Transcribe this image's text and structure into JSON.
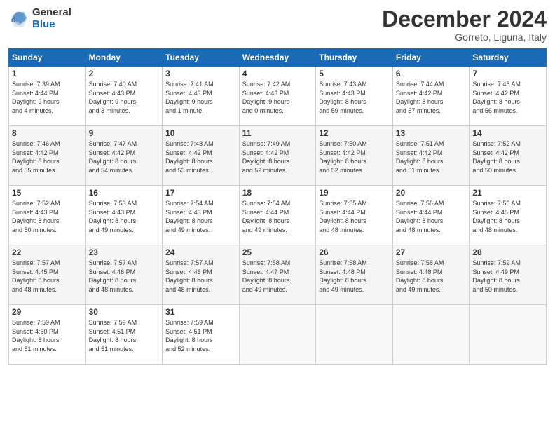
{
  "logo": {
    "general": "General",
    "blue": "Blue"
  },
  "title": "December 2024",
  "subtitle": "Gorreto, Liguria, Italy",
  "days_header": [
    "Sunday",
    "Monday",
    "Tuesday",
    "Wednesday",
    "Thursday",
    "Friday",
    "Saturday"
  ],
  "weeks": [
    [
      {
        "day": "1",
        "info": "Sunrise: 7:39 AM\nSunset: 4:44 PM\nDaylight: 9 hours\nand 4 minutes."
      },
      {
        "day": "2",
        "info": "Sunrise: 7:40 AM\nSunset: 4:43 PM\nDaylight: 9 hours\nand 3 minutes."
      },
      {
        "day": "3",
        "info": "Sunrise: 7:41 AM\nSunset: 4:43 PM\nDaylight: 9 hours\nand 1 minute."
      },
      {
        "day": "4",
        "info": "Sunrise: 7:42 AM\nSunset: 4:43 PM\nDaylight: 9 hours\nand 0 minutes."
      },
      {
        "day": "5",
        "info": "Sunrise: 7:43 AM\nSunset: 4:43 PM\nDaylight: 8 hours\nand 59 minutes."
      },
      {
        "day": "6",
        "info": "Sunrise: 7:44 AM\nSunset: 4:42 PM\nDaylight: 8 hours\nand 57 minutes."
      },
      {
        "day": "7",
        "info": "Sunrise: 7:45 AM\nSunset: 4:42 PM\nDaylight: 8 hours\nand 56 minutes."
      }
    ],
    [
      {
        "day": "8",
        "info": "Sunrise: 7:46 AM\nSunset: 4:42 PM\nDaylight: 8 hours\nand 55 minutes."
      },
      {
        "day": "9",
        "info": "Sunrise: 7:47 AM\nSunset: 4:42 PM\nDaylight: 8 hours\nand 54 minutes."
      },
      {
        "day": "10",
        "info": "Sunrise: 7:48 AM\nSunset: 4:42 PM\nDaylight: 8 hours\nand 53 minutes."
      },
      {
        "day": "11",
        "info": "Sunrise: 7:49 AM\nSunset: 4:42 PM\nDaylight: 8 hours\nand 52 minutes."
      },
      {
        "day": "12",
        "info": "Sunrise: 7:50 AM\nSunset: 4:42 PM\nDaylight: 8 hours\nand 52 minutes."
      },
      {
        "day": "13",
        "info": "Sunrise: 7:51 AM\nSunset: 4:42 PM\nDaylight: 8 hours\nand 51 minutes."
      },
      {
        "day": "14",
        "info": "Sunrise: 7:52 AM\nSunset: 4:42 PM\nDaylight: 8 hours\nand 50 minutes."
      }
    ],
    [
      {
        "day": "15",
        "info": "Sunrise: 7:52 AM\nSunset: 4:43 PM\nDaylight: 8 hours\nand 50 minutes."
      },
      {
        "day": "16",
        "info": "Sunrise: 7:53 AM\nSunset: 4:43 PM\nDaylight: 8 hours\nand 49 minutes."
      },
      {
        "day": "17",
        "info": "Sunrise: 7:54 AM\nSunset: 4:43 PM\nDaylight: 8 hours\nand 49 minutes."
      },
      {
        "day": "18",
        "info": "Sunrise: 7:54 AM\nSunset: 4:44 PM\nDaylight: 8 hours\nand 49 minutes."
      },
      {
        "day": "19",
        "info": "Sunrise: 7:55 AM\nSunset: 4:44 PM\nDaylight: 8 hours\nand 48 minutes."
      },
      {
        "day": "20",
        "info": "Sunrise: 7:56 AM\nSunset: 4:44 PM\nDaylight: 8 hours\nand 48 minutes."
      },
      {
        "day": "21",
        "info": "Sunrise: 7:56 AM\nSunset: 4:45 PM\nDaylight: 8 hours\nand 48 minutes."
      }
    ],
    [
      {
        "day": "22",
        "info": "Sunrise: 7:57 AM\nSunset: 4:45 PM\nDaylight: 8 hours\nand 48 minutes."
      },
      {
        "day": "23",
        "info": "Sunrise: 7:57 AM\nSunset: 4:46 PM\nDaylight: 8 hours\nand 48 minutes."
      },
      {
        "day": "24",
        "info": "Sunrise: 7:57 AM\nSunset: 4:46 PM\nDaylight: 8 hours\nand 48 minutes."
      },
      {
        "day": "25",
        "info": "Sunrise: 7:58 AM\nSunset: 4:47 PM\nDaylight: 8 hours\nand 49 minutes."
      },
      {
        "day": "26",
        "info": "Sunrise: 7:58 AM\nSunset: 4:48 PM\nDaylight: 8 hours\nand 49 minutes."
      },
      {
        "day": "27",
        "info": "Sunrise: 7:58 AM\nSunset: 4:48 PM\nDaylight: 8 hours\nand 49 minutes."
      },
      {
        "day": "28",
        "info": "Sunrise: 7:59 AM\nSunset: 4:49 PM\nDaylight: 8 hours\nand 50 minutes."
      }
    ],
    [
      {
        "day": "29",
        "info": "Sunrise: 7:59 AM\nSunset: 4:50 PM\nDaylight: 8 hours\nand 51 minutes."
      },
      {
        "day": "30",
        "info": "Sunrise: 7:59 AM\nSunset: 4:51 PM\nDaylight: 8 hours\nand 51 minutes."
      },
      {
        "day": "31",
        "info": "Sunrise: 7:59 AM\nSunset: 4:51 PM\nDaylight: 8 hours\nand 52 minutes."
      },
      {
        "day": "",
        "info": ""
      },
      {
        "day": "",
        "info": ""
      },
      {
        "day": "",
        "info": ""
      },
      {
        "day": "",
        "info": ""
      }
    ]
  ]
}
